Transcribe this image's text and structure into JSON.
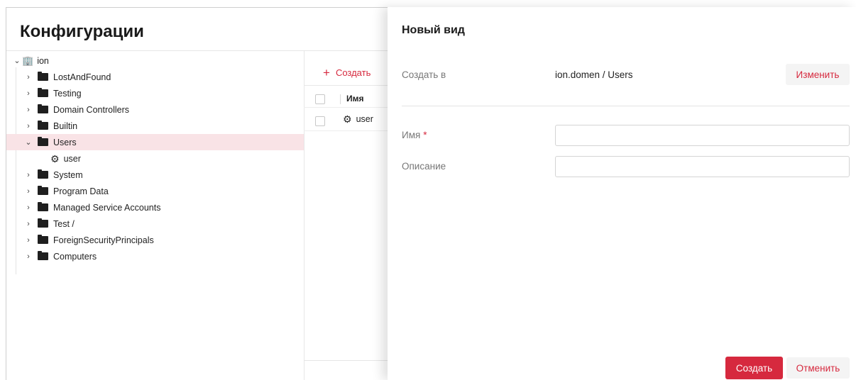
{
  "page": {
    "title": "Конфигурации"
  },
  "tree": {
    "root": {
      "label": "ion",
      "chevron": "⌄",
      "icon": "building-icon"
    },
    "items": [
      {
        "label": "LostAndFound",
        "chevron": "›"
      },
      {
        "label": "Testing",
        "chevron": "›"
      },
      {
        "label": "Domain Controllers",
        "chevron": "›"
      },
      {
        "label": "Builtin",
        "chevron": "›"
      },
      {
        "label": "Users",
        "chevron": "⌄",
        "selected": true
      },
      {
        "label": "user",
        "child": true,
        "icon": "user-gear-icon"
      },
      {
        "label": "System",
        "chevron": "›"
      },
      {
        "label": "Program Data",
        "chevron": "›"
      },
      {
        "label": "Managed Service Accounts",
        "chevron": "›"
      },
      {
        "label": "Test /",
        "chevron": "›"
      },
      {
        "label": "ForeignSecurityPrincipals",
        "chevron": "›"
      },
      {
        "label": "Computers",
        "chevron": "›"
      }
    ]
  },
  "list": {
    "create_label": "Создать",
    "column_name": "Имя",
    "rows": [
      {
        "label": "user"
      }
    ]
  },
  "drawer": {
    "title": "Новый вид",
    "create_in_label": "Создать в",
    "create_in_value": "ion.domen / Users",
    "change_label": "Изменить",
    "name_label": "Имя",
    "name_required": "*",
    "name_value": "",
    "description_label": "Описание",
    "description_value": "",
    "submit_label": "Создать",
    "cancel_label": "Отменить"
  },
  "colors": {
    "accent": "#d6293e",
    "selected_bg": "#f9e3e6"
  }
}
